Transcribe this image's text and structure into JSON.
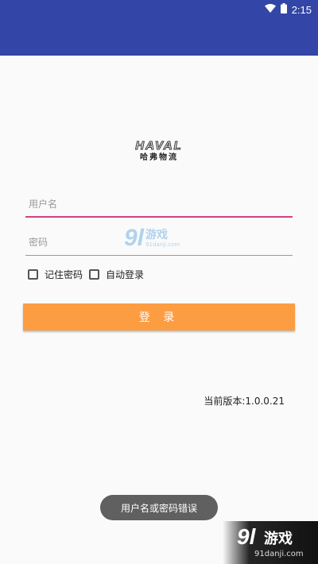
{
  "status_bar": {
    "time": "2:15",
    "color": "#3345a6"
  },
  "logo": {
    "brand": "HAVAL",
    "subtitle": "哈弗物流"
  },
  "form": {
    "username_placeholder": "用户名",
    "password_placeholder": "密码",
    "remember_password": "记住密码",
    "auto_login": "自动登录",
    "login_button": "登 录",
    "login_button_color": "#fd9d42"
  },
  "version": "当前版本:1.0.0.21",
  "toast": "用户名或密码错误",
  "watermarks": {
    "number": "9l",
    "name": "游戏",
    "url": "91danji.com"
  }
}
